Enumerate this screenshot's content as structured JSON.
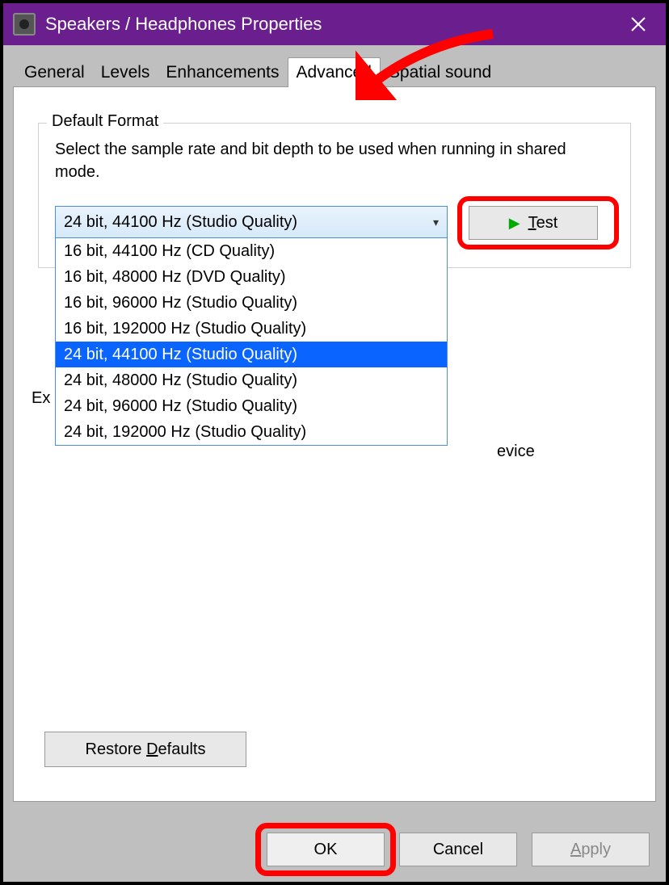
{
  "titlebar": {
    "title": "Speakers / Headphones Properties"
  },
  "tabs": {
    "general": "General",
    "levels": "Levels",
    "enhancements": "Enhancements",
    "advanced": "Advanced",
    "spatial": "Spatial sound"
  },
  "group": {
    "legend": "Default Format",
    "description": "Select the sample rate and bit depth to be used when running in shared mode."
  },
  "combo": {
    "selected": "24 bit, 44100 Hz (Studio Quality)",
    "options": [
      "16 bit, 44100 Hz (CD Quality)",
      "16 bit, 48000 Hz (DVD Quality)",
      "16 bit, 96000 Hz (Studio Quality)",
      "16 bit, 192000 Hz (Studio Quality)",
      "24 bit, 44100 Hz (Studio Quality)",
      "24 bit, 48000 Hz (Studio Quality)",
      "24 bit, 96000 Hz (Studio Quality)",
      "24 bit, 192000 Hz (Studio Quality)"
    ],
    "selected_index": 4
  },
  "test_button": "Test",
  "behind": {
    "left_fragment": "Ex",
    "right_fragment": "evice"
  },
  "restore": "Restore Defaults",
  "footer": {
    "ok": "OK",
    "cancel": "Cancel",
    "apply": "Apply"
  }
}
